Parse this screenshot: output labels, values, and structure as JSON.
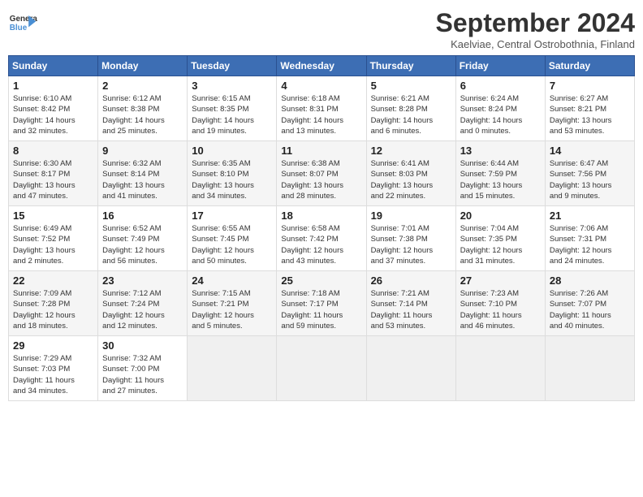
{
  "header": {
    "logo_line1": "General",
    "logo_line2": "Blue",
    "title": "September 2024",
    "subtitle": "Kaelviae, Central Ostrobothnia, Finland"
  },
  "days_of_week": [
    "Sunday",
    "Monday",
    "Tuesday",
    "Wednesday",
    "Thursday",
    "Friday",
    "Saturday"
  ],
  "weeks": [
    [
      {
        "day": "1",
        "info": "Sunrise: 6:10 AM\nSunset: 8:42 PM\nDaylight: 14 hours\nand 32 minutes."
      },
      {
        "day": "2",
        "info": "Sunrise: 6:12 AM\nSunset: 8:38 PM\nDaylight: 14 hours\nand 25 minutes."
      },
      {
        "day": "3",
        "info": "Sunrise: 6:15 AM\nSunset: 8:35 PM\nDaylight: 14 hours\nand 19 minutes."
      },
      {
        "day": "4",
        "info": "Sunrise: 6:18 AM\nSunset: 8:31 PM\nDaylight: 14 hours\nand 13 minutes."
      },
      {
        "day": "5",
        "info": "Sunrise: 6:21 AM\nSunset: 8:28 PM\nDaylight: 14 hours\nand 6 minutes."
      },
      {
        "day": "6",
        "info": "Sunrise: 6:24 AM\nSunset: 8:24 PM\nDaylight: 14 hours\nand 0 minutes."
      },
      {
        "day": "7",
        "info": "Sunrise: 6:27 AM\nSunset: 8:21 PM\nDaylight: 13 hours\nand 53 minutes."
      }
    ],
    [
      {
        "day": "8",
        "info": "Sunrise: 6:30 AM\nSunset: 8:17 PM\nDaylight: 13 hours\nand 47 minutes."
      },
      {
        "day": "9",
        "info": "Sunrise: 6:32 AM\nSunset: 8:14 PM\nDaylight: 13 hours\nand 41 minutes."
      },
      {
        "day": "10",
        "info": "Sunrise: 6:35 AM\nSunset: 8:10 PM\nDaylight: 13 hours\nand 34 minutes."
      },
      {
        "day": "11",
        "info": "Sunrise: 6:38 AM\nSunset: 8:07 PM\nDaylight: 13 hours\nand 28 minutes."
      },
      {
        "day": "12",
        "info": "Sunrise: 6:41 AM\nSunset: 8:03 PM\nDaylight: 13 hours\nand 22 minutes."
      },
      {
        "day": "13",
        "info": "Sunrise: 6:44 AM\nSunset: 7:59 PM\nDaylight: 13 hours\nand 15 minutes."
      },
      {
        "day": "14",
        "info": "Sunrise: 6:47 AM\nSunset: 7:56 PM\nDaylight: 13 hours\nand 9 minutes."
      }
    ],
    [
      {
        "day": "15",
        "info": "Sunrise: 6:49 AM\nSunset: 7:52 PM\nDaylight: 13 hours\nand 2 minutes."
      },
      {
        "day": "16",
        "info": "Sunrise: 6:52 AM\nSunset: 7:49 PM\nDaylight: 12 hours\nand 56 minutes."
      },
      {
        "day": "17",
        "info": "Sunrise: 6:55 AM\nSunset: 7:45 PM\nDaylight: 12 hours\nand 50 minutes."
      },
      {
        "day": "18",
        "info": "Sunrise: 6:58 AM\nSunset: 7:42 PM\nDaylight: 12 hours\nand 43 minutes."
      },
      {
        "day": "19",
        "info": "Sunrise: 7:01 AM\nSunset: 7:38 PM\nDaylight: 12 hours\nand 37 minutes."
      },
      {
        "day": "20",
        "info": "Sunrise: 7:04 AM\nSunset: 7:35 PM\nDaylight: 12 hours\nand 31 minutes."
      },
      {
        "day": "21",
        "info": "Sunrise: 7:06 AM\nSunset: 7:31 PM\nDaylight: 12 hours\nand 24 minutes."
      }
    ],
    [
      {
        "day": "22",
        "info": "Sunrise: 7:09 AM\nSunset: 7:28 PM\nDaylight: 12 hours\nand 18 minutes."
      },
      {
        "day": "23",
        "info": "Sunrise: 7:12 AM\nSunset: 7:24 PM\nDaylight: 12 hours\nand 12 minutes."
      },
      {
        "day": "24",
        "info": "Sunrise: 7:15 AM\nSunset: 7:21 PM\nDaylight: 12 hours\nand 5 minutes."
      },
      {
        "day": "25",
        "info": "Sunrise: 7:18 AM\nSunset: 7:17 PM\nDaylight: 11 hours\nand 59 minutes."
      },
      {
        "day": "26",
        "info": "Sunrise: 7:21 AM\nSunset: 7:14 PM\nDaylight: 11 hours\nand 53 minutes."
      },
      {
        "day": "27",
        "info": "Sunrise: 7:23 AM\nSunset: 7:10 PM\nDaylight: 11 hours\nand 46 minutes."
      },
      {
        "day": "28",
        "info": "Sunrise: 7:26 AM\nSunset: 7:07 PM\nDaylight: 11 hours\nand 40 minutes."
      }
    ],
    [
      {
        "day": "29",
        "info": "Sunrise: 7:29 AM\nSunset: 7:03 PM\nDaylight: 11 hours\nand 34 minutes."
      },
      {
        "day": "30",
        "info": "Sunrise: 7:32 AM\nSunset: 7:00 PM\nDaylight: 11 hours\nand 27 minutes."
      },
      {
        "day": "",
        "info": ""
      },
      {
        "day": "",
        "info": ""
      },
      {
        "day": "",
        "info": ""
      },
      {
        "day": "",
        "info": ""
      },
      {
        "day": "",
        "info": ""
      }
    ]
  ]
}
